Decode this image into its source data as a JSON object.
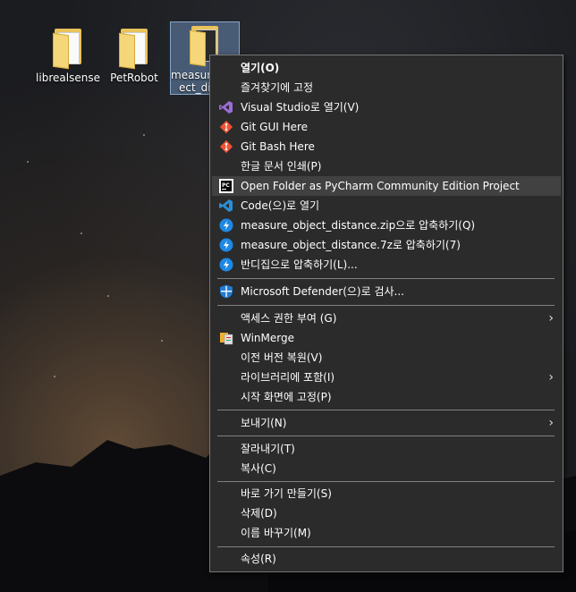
{
  "desktop": {
    "icons": [
      {
        "label": "librealsense"
      },
      {
        "label": "PetRobot"
      },
      {
        "label": "measure_obj\nect_dist..."
      }
    ]
  },
  "menu": {
    "items": [
      {
        "label": "열기(O)",
        "bold": true
      },
      {
        "label": "즐겨찾기에 고정"
      },
      {
        "label": "Visual Studio로 열기(V)",
        "icon": "visual-studio-icon"
      },
      {
        "label": "Git GUI Here",
        "icon": "git-icon"
      },
      {
        "label": "Git Bash Here",
        "icon": "git-icon"
      },
      {
        "label": "한글 문서 인쇄(P)"
      },
      {
        "label": "Open Folder as PyCharm Community Edition Project",
        "icon": "pycharm-icon"
      },
      {
        "label": "Code(으)로 열기",
        "icon": "vscode-icon"
      },
      {
        "label": "measure_object_distance.zip으로 압축하기(Q)",
        "icon": "bandizip-icon"
      },
      {
        "label": "measure_object_distance.7z로 압축하기(7)",
        "icon": "bandizip-icon"
      },
      {
        "label": "반디집으로 압축하기(L)...",
        "icon": "bandizip-icon"
      },
      {
        "label": "Microsoft Defender(으)로 검사...",
        "icon": "defender-icon"
      },
      {
        "label": "액세스 권한 부여 (G)",
        "submenu": true
      },
      {
        "label": "WinMerge",
        "icon": "winmerge-icon"
      },
      {
        "label": "이전 버전 복원(V)"
      },
      {
        "label": "라이브러리에 포함(I)",
        "submenu": true
      },
      {
        "label": "시작 화면에 고정(P)"
      },
      {
        "label": "보내기(N)",
        "submenu": true
      },
      {
        "label": "잘라내기(T)"
      },
      {
        "label": "복사(C)"
      },
      {
        "label": "바로 가기 만들기(S)"
      },
      {
        "label": "삭제(D)"
      },
      {
        "label": "이름 바꾸기(M)"
      },
      {
        "label": "속성(R)"
      }
    ],
    "submenu_arrow": "›"
  }
}
